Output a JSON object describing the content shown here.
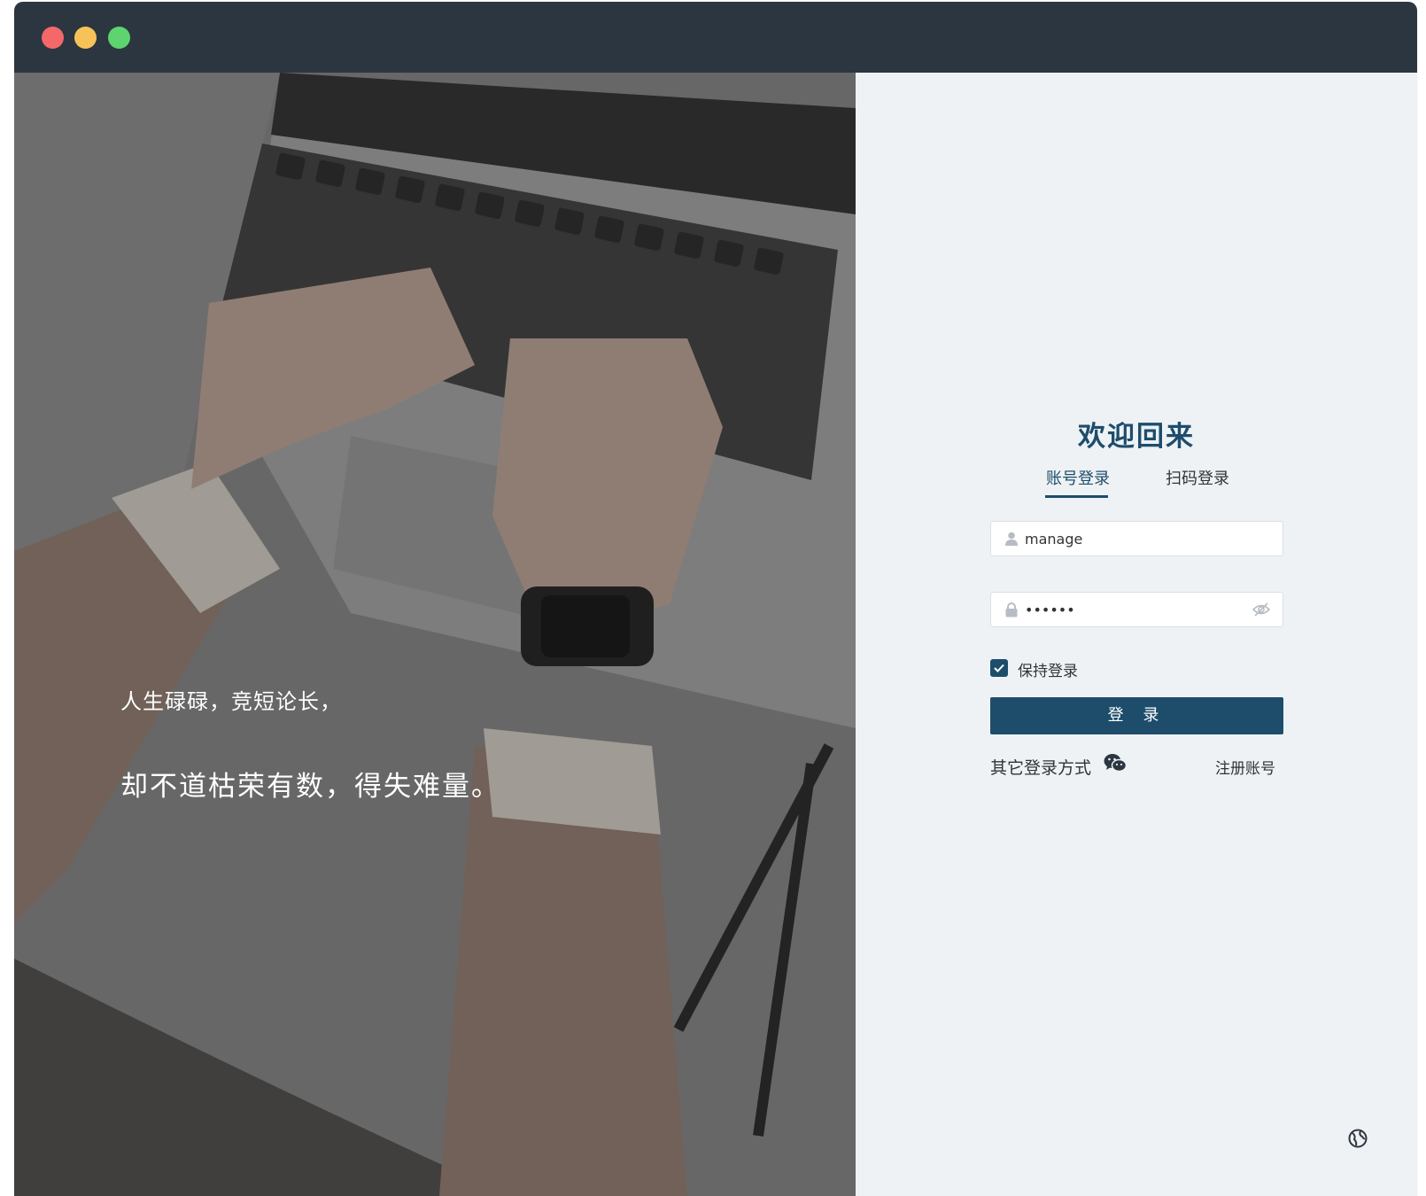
{
  "photo": {
    "quote_line1": "人生碌碌，竞短论长，",
    "quote_line2": "却不道枯荣有数，得失难量。"
  },
  "login": {
    "title": "欢迎回来",
    "tabs": [
      {
        "label": "账号登录",
        "active": true
      },
      {
        "label": "扫码登录",
        "active": false
      }
    ],
    "username": {
      "value": "manage",
      "icon": "user-icon"
    },
    "password": {
      "value": "••••••",
      "icon": "lock-icon",
      "toggle_icon": "eye-off-icon"
    },
    "remember": {
      "label": "保持登录",
      "checked": true
    },
    "submit_label": "登 录",
    "other_login_label": "其它登录方式",
    "other_login_icon": "wechat-icon",
    "register_label": "注册账号",
    "language_icon": "globe-icon"
  },
  "colors": {
    "accent": "#1e4d6b",
    "titlebar": "#2c3640",
    "panel_bg": "#eef2f5"
  }
}
